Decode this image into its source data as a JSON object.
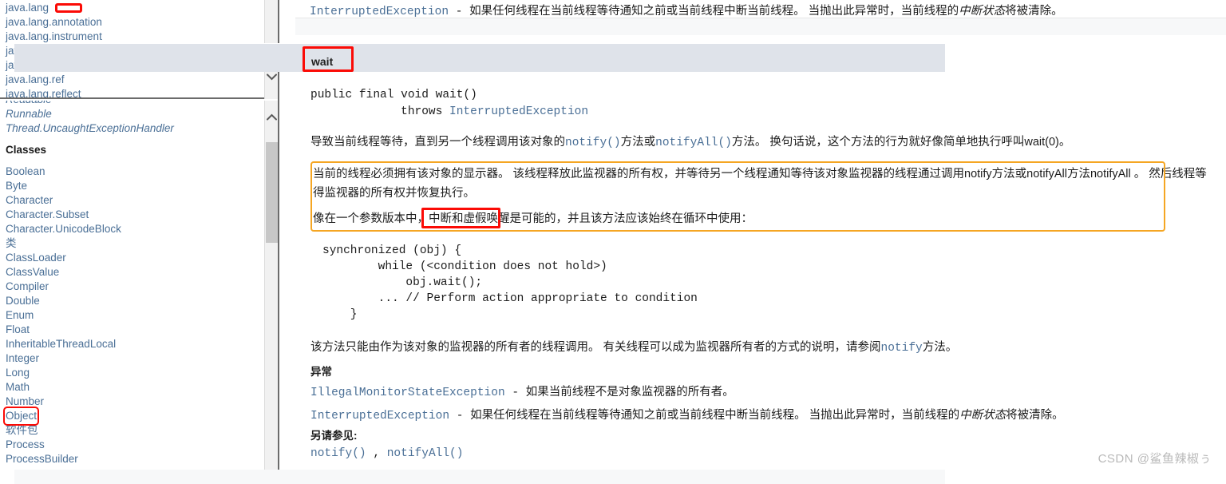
{
  "sidebar": {
    "packages": [
      {
        "label": "java.lang",
        "marked": true
      },
      {
        "label": "java.lang.annotation",
        "marked": false
      },
      {
        "label": "java.lang.instrument",
        "marked": false
      },
      {
        "label": "java.lang.invoke",
        "marked": false
      },
      {
        "label": "java.lang.management",
        "marked": false
      },
      {
        "label": "java.lang.ref",
        "marked": false
      },
      {
        "label": "java.lang.reflect",
        "marked": false
      }
    ],
    "classes": [
      {
        "label": "Readable",
        "style": "italic",
        "marked": false
      },
      {
        "label": "Runnable",
        "style": "italic",
        "marked": false
      },
      {
        "label": "Thread.UncaughtExceptionHandler",
        "style": "italic",
        "marked": false
      },
      {
        "label": "Classes",
        "style": "heading",
        "marked": false
      },
      {
        "label": "Boolean",
        "style": "link",
        "marked": false
      },
      {
        "label": "Byte",
        "style": "link",
        "marked": false
      },
      {
        "label": "Character",
        "style": "link",
        "marked": false
      },
      {
        "label": "Character.Subset",
        "style": "link",
        "marked": false
      },
      {
        "label": "Character.UnicodeBlock",
        "style": "link",
        "marked": false
      },
      {
        "label": "类",
        "style": "cjk",
        "marked": false
      },
      {
        "label": "ClassLoader",
        "style": "link",
        "marked": false
      },
      {
        "label": "ClassValue",
        "style": "link",
        "marked": false
      },
      {
        "label": "Compiler",
        "style": "link",
        "marked": false
      },
      {
        "label": "Double",
        "style": "link",
        "marked": false
      },
      {
        "label": "Enum",
        "style": "link",
        "marked": false
      },
      {
        "label": "Float",
        "style": "link",
        "marked": false
      },
      {
        "label": "InheritableThreadLocal",
        "style": "link",
        "marked": false
      },
      {
        "label": "Integer",
        "style": "link",
        "marked": false
      },
      {
        "label": "Long",
        "style": "link",
        "marked": false
      },
      {
        "label": "Math",
        "style": "link",
        "marked": false
      },
      {
        "label": "Number",
        "style": "link",
        "marked": false
      },
      {
        "label": "Object",
        "style": "link",
        "marked": true
      },
      {
        "label": "软件包",
        "style": "cjk",
        "marked": false
      },
      {
        "label": "Process",
        "style": "link",
        "marked": false
      },
      {
        "label": "ProcessBuilder",
        "style": "link",
        "marked": false
      }
    ],
    "scrollbars": {
      "packages_arrow": "chevron-down-icon",
      "classes_arrow": "chevron-up-icon"
    }
  },
  "content": {
    "top_exception": {
      "name": "InterruptedException",
      "dash": " - ",
      "text_a": "如果任何线程在当前线程等待通知之前或当前线程中断当前线程。",
      "text_b": " 当抛出此异常时，当前线程的",
      "italic": "中断状态",
      "text_c": "将被清除。"
    },
    "method_header": "wait",
    "signature": {
      "line1": "public final void wait()",
      "line2": "             throws ",
      "line2_link": "InterruptedException"
    },
    "description": {
      "p1_a": "导致当前线程等待，直到另一个线程调用该对象的",
      "p1_notify": "notify()",
      "p1_b": "方法或",
      "p1_notifyall": "notifyAll()",
      "p1_c": "方法。 换句话说，这个方法的行为就好像简单地执行呼叫wait(0)。"
    },
    "highlight_paragraph": {
      "line1": "当前的线程必须拥有该对象的显示器。 该线程释放此监视器的所有权，并等待另一个线程通知等待该对象监视器的线程通过调用notify方法或notifyAll方法notifyAll 。",
      "line1_tail": " 然后线程等",
      "line2": "得监视器的所有权并恢复执行。",
      "line3_a": "像在一个参数版本中，",
      "line3_marked": "中断和虚假唤醒",
      "line3_b": "是可能的，并且该方法应该始终在循环中使用："
    },
    "code_block": [
      "synchronized (obj) {",
      "        while (<condition does not hold>)",
      "            obj.wait();",
      "        ... // Perform action appropriate to condition",
      "    }"
    ],
    "note": {
      "text_a": "该方法只能由作为该对象的监视器的所有者的线程调用。 有关线程可以成为监视器所有者的方式的说明，请参阅",
      "link": "notify",
      "text_b": "方法。"
    },
    "throws_heading": "异常",
    "throws": [
      {
        "name": "IllegalMonitorStateException",
        "dash": " - ",
        "text_a": "如果当前线程不是对象监视器的所有者。",
        "text_b": "",
        "italic": "",
        "text_c": ""
      },
      {
        "name": "InterruptedException",
        "dash": " - ",
        "text_a": "如果任何线程在当前线程等待通知之前或当前线程中断当前线程。",
        "text_b": " 当抛出此异常时，当前线程的",
        "italic": "中断状态",
        "text_c": "将被清除。"
      }
    ],
    "see_also_heading": "另请参见:",
    "see_also": [
      "notify()",
      ",",
      "notifyAll()"
    ]
  },
  "watermark": "CSDN @鲨鱼辣椒ぅ",
  "colors": {
    "link": "#4a6f96",
    "red_marker": "#fb0b06",
    "orange_marker": "#f5a623",
    "header_bar": "#dfe3ea"
  }
}
